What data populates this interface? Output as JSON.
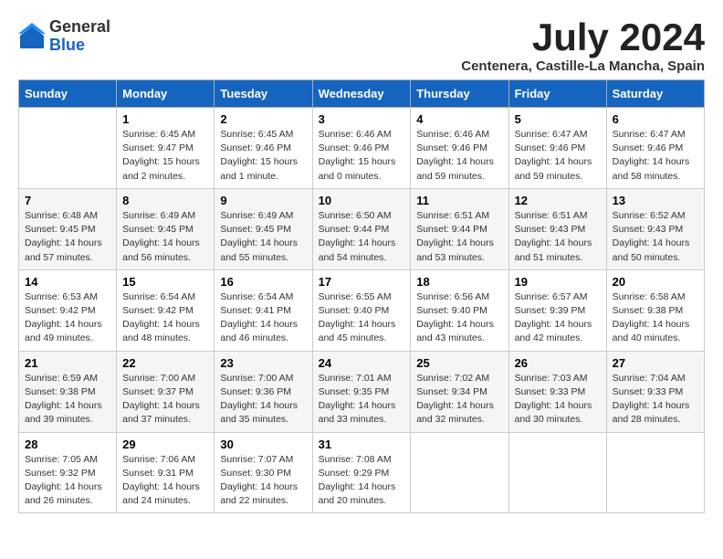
{
  "header": {
    "logo_general": "General",
    "logo_blue": "Blue",
    "month_title": "July 2024",
    "location": "Centenera, Castille-La Mancha, Spain"
  },
  "weekdays": [
    "Sunday",
    "Monday",
    "Tuesday",
    "Wednesday",
    "Thursday",
    "Friday",
    "Saturday"
  ],
  "weeks": [
    [
      {
        "day": "",
        "info": ""
      },
      {
        "day": "1",
        "info": "Sunrise: 6:45 AM\nSunset: 9:47 PM\nDaylight: 15 hours\nand 2 minutes."
      },
      {
        "day": "2",
        "info": "Sunrise: 6:45 AM\nSunset: 9:46 PM\nDaylight: 15 hours\nand 1 minute."
      },
      {
        "day": "3",
        "info": "Sunrise: 6:46 AM\nSunset: 9:46 PM\nDaylight: 15 hours\nand 0 minutes."
      },
      {
        "day": "4",
        "info": "Sunrise: 6:46 AM\nSunset: 9:46 PM\nDaylight: 14 hours\nand 59 minutes."
      },
      {
        "day": "5",
        "info": "Sunrise: 6:47 AM\nSunset: 9:46 PM\nDaylight: 14 hours\nand 59 minutes."
      },
      {
        "day": "6",
        "info": "Sunrise: 6:47 AM\nSunset: 9:46 PM\nDaylight: 14 hours\nand 58 minutes."
      }
    ],
    [
      {
        "day": "7",
        "info": "Sunrise: 6:48 AM\nSunset: 9:45 PM\nDaylight: 14 hours\nand 57 minutes."
      },
      {
        "day": "8",
        "info": "Sunrise: 6:49 AM\nSunset: 9:45 PM\nDaylight: 14 hours\nand 56 minutes."
      },
      {
        "day": "9",
        "info": "Sunrise: 6:49 AM\nSunset: 9:45 PM\nDaylight: 14 hours\nand 55 minutes."
      },
      {
        "day": "10",
        "info": "Sunrise: 6:50 AM\nSunset: 9:44 PM\nDaylight: 14 hours\nand 54 minutes."
      },
      {
        "day": "11",
        "info": "Sunrise: 6:51 AM\nSunset: 9:44 PM\nDaylight: 14 hours\nand 53 minutes."
      },
      {
        "day": "12",
        "info": "Sunrise: 6:51 AM\nSunset: 9:43 PM\nDaylight: 14 hours\nand 51 minutes."
      },
      {
        "day": "13",
        "info": "Sunrise: 6:52 AM\nSunset: 9:43 PM\nDaylight: 14 hours\nand 50 minutes."
      }
    ],
    [
      {
        "day": "14",
        "info": "Sunrise: 6:53 AM\nSunset: 9:42 PM\nDaylight: 14 hours\nand 49 minutes."
      },
      {
        "day": "15",
        "info": "Sunrise: 6:54 AM\nSunset: 9:42 PM\nDaylight: 14 hours\nand 48 minutes."
      },
      {
        "day": "16",
        "info": "Sunrise: 6:54 AM\nSunset: 9:41 PM\nDaylight: 14 hours\nand 46 minutes."
      },
      {
        "day": "17",
        "info": "Sunrise: 6:55 AM\nSunset: 9:40 PM\nDaylight: 14 hours\nand 45 minutes."
      },
      {
        "day": "18",
        "info": "Sunrise: 6:56 AM\nSunset: 9:40 PM\nDaylight: 14 hours\nand 43 minutes."
      },
      {
        "day": "19",
        "info": "Sunrise: 6:57 AM\nSunset: 9:39 PM\nDaylight: 14 hours\nand 42 minutes."
      },
      {
        "day": "20",
        "info": "Sunrise: 6:58 AM\nSunset: 9:38 PM\nDaylight: 14 hours\nand 40 minutes."
      }
    ],
    [
      {
        "day": "21",
        "info": "Sunrise: 6:59 AM\nSunset: 9:38 PM\nDaylight: 14 hours\nand 39 minutes."
      },
      {
        "day": "22",
        "info": "Sunrise: 7:00 AM\nSunset: 9:37 PM\nDaylight: 14 hours\nand 37 minutes."
      },
      {
        "day": "23",
        "info": "Sunrise: 7:00 AM\nSunset: 9:36 PM\nDaylight: 14 hours\nand 35 minutes."
      },
      {
        "day": "24",
        "info": "Sunrise: 7:01 AM\nSunset: 9:35 PM\nDaylight: 14 hours\nand 33 minutes."
      },
      {
        "day": "25",
        "info": "Sunrise: 7:02 AM\nSunset: 9:34 PM\nDaylight: 14 hours\nand 32 minutes."
      },
      {
        "day": "26",
        "info": "Sunrise: 7:03 AM\nSunset: 9:33 PM\nDaylight: 14 hours\nand 30 minutes."
      },
      {
        "day": "27",
        "info": "Sunrise: 7:04 AM\nSunset: 9:33 PM\nDaylight: 14 hours\nand 28 minutes."
      }
    ],
    [
      {
        "day": "28",
        "info": "Sunrise: 7:05 AM\nSunset: 9:32 PM\nDaylight: 14 hours\nand 26 minutes."
      },
      {
        "day": "29",
        "info": "Sunrise: 7:06 AM\nSunset: 9:31 PM\nDaylight: 14 hours\nand 24 minutes."
      },
      {
        "day": "30",
        "info": "Sunrise: 7:07 AM\nSunset: 9:30 PM\nDaylight: 14 hours\nand 22 minutes."
      },
      {
        "day": "31",
        "info": "Sunrise: 7:08 AM\nSunset: 9:29 PM\nDaylight: 14 hours\nand 20 minutes."
      },
      {
        "day": "",
        "info": ""
      },
      {
        "day": "",
        "info": ""
      },
      {
        "day": "",
        "info": ""
      }
    ]
  ]
}
